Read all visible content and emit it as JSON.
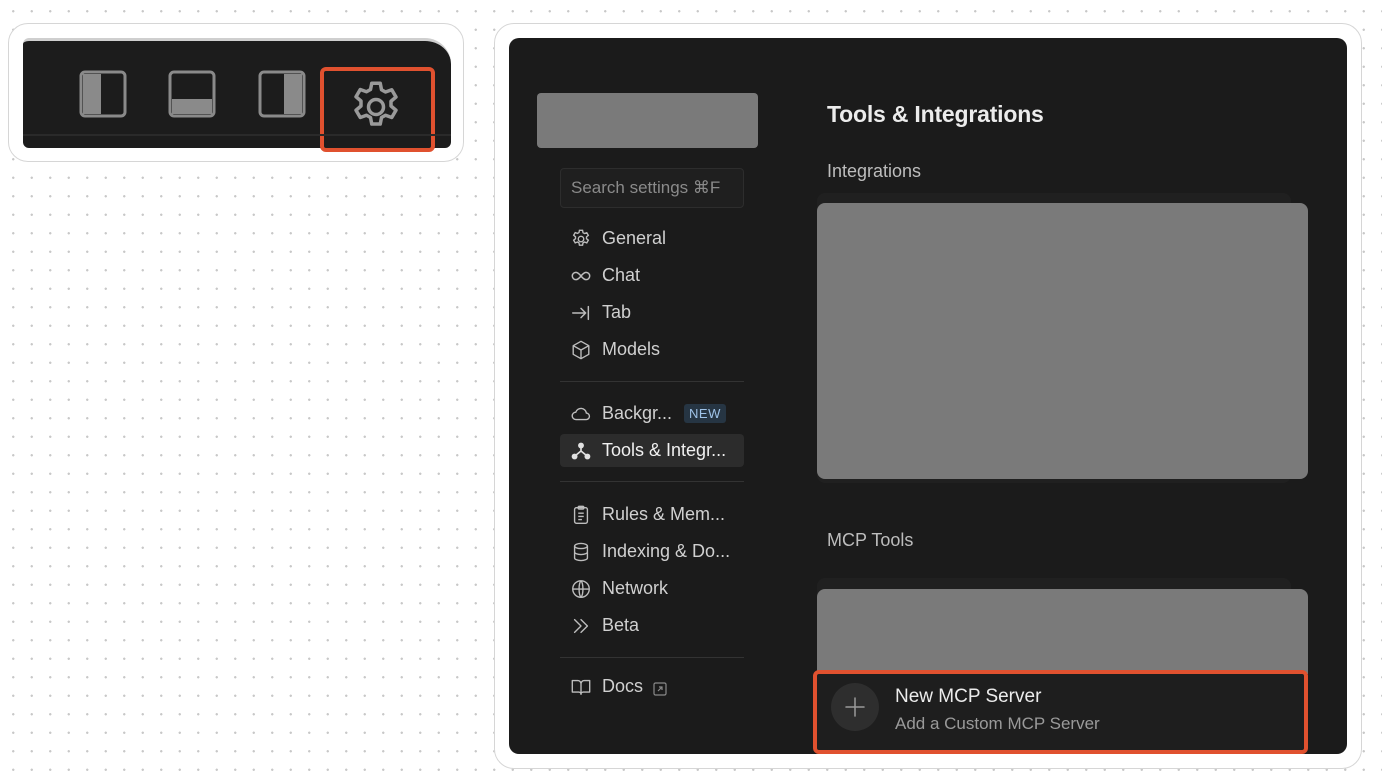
{
  "toolbar": {
    "icons": [
      "toggle-left-panel-icon",
      "toggle-bottom-panel-icon",
      "toggle-right-panel-icon",
      "gear-icon"
    ],
    "highlight_color": "#e0512f"
  },
  "settings": {
    "search_placeholder": "Search settings ⌘F",
    "nav": {
      "general": "General",
      "chat": "Chat",
      "tab": "Tab",
      "models": "Models",
      "background": "Backgr...",
      "background_badge": "NEW",
      "tools": "Tools & Integr...",
      "rules": "Rules & Mem...",
      "indexing": "Indexing & Do...",
      "network": "Network",
      "beta": "Beta",
      "docs": "Docs"
    },
    "page_title": "Tools & Integrations",
    "integrations_label": "Integrations",
    "mcp_tools_label": "MCP Tools",
    "new_mcp_title": "New MCP Server",
    "new_mcp_subtitle": "Add a Custom MCP Server"
  },
  "colors": {
    "panel_bg": "#1b1b1b",
    "redacted_block": "#7a7a7a",
    "highlight": "#e0512f",
    "badge_text": "#9fc3e8"
  }
}
